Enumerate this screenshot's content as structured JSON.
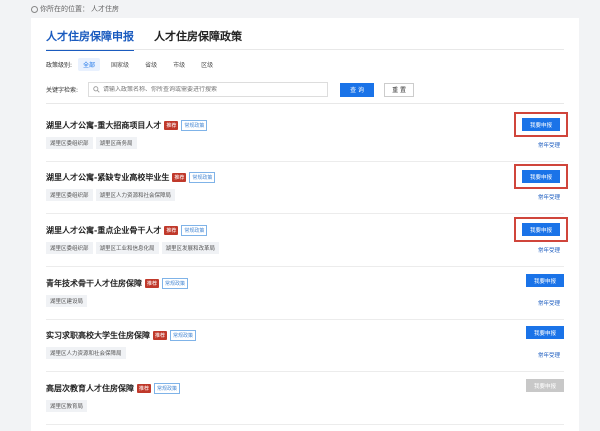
{
  "breadcrumb": {
    "label": "你所在的位置：",
    "current": "人才住房"
  },
  "tabs": [
    {
      "label": "人才住房保障申报"
    },
    {
      "label": "人才住房保障政策"
    }
  ],
  "filter": {
    "label": "政策级别:",
    "options": [
      "全部",
      "国家级",
      "省级",
      "市级",
      "区级"
    ],
    "selected": "全部"
  },
  "search": {
    "label": "关键字检索:",
    "placeholder": "请输入政策名称、你所查询或需要进行搜索",
    "search_label": "查 询",
    "reset_label": "重 置"
  },
  "items": [
    {
      "title": "湖里人才公寓-重大招商项目人才",
      "rec": "推荐",
      "type": "常规政策",
      "orgs": [
        "湖里区委组织部",
        "湖里区商务局"
      ],
      "apply": "我要申报",
      "status": "常年受理",
      "highlight": true,
      "disabled": false
    },
    {
      "title": "湖里人才公寓-紧缺专业高校毕业生",
      "rec": "推荐",
      "type": "常规政策",
      "orgs": [
        "湖里区委组织部",
        "湖里区人力资源和社会保障局"
      ],
      "apply": "我要申报",
      "status": "常年受理",
      "highlight": true,
      "disabled": false
    },
    {
      "title": "湖里人才公寓-重点企业骨干人才",
      "rec": "推荐",
      "type": "常规政策",
      "orgs": [
        "湖里区委组织部",
        "湖里区工业和信息化局",
        "湖里区发展和改革局"
      ],
      "apply": "我要申报",
      "status": "常年受理",
      "highlight": true,
      "disabled": false
    },
    {
      "title": "青年技术骨干人才住房保障",
      "rec": "推荐",
      "type": "常规政策",
      "orgs": [
        "湖里区建设局"
      ],
      "apply": "我要申报",
      "status": "常年受理",
      "highlight": false,
      "disabled": false
    },
    {
      "title": "实习求职高校大学生住房保障",
      "rec": "推荐",
      "type": "常规政策",
      "orgs": [
        "湖里区人力资源和社会保障局"
      ],
      "apply": "我要申报",
      "status": "常年受理",
      "highlight": false,
      "disabled": false
    },
    {
      "title": "高层次教育人才住房保障",
      "rec": "推荐",
      "type": "常规政策",
      "orgs": [
        "湖里区教育局"
      ],
      "apply": "我要申报",
      "status": "",
      "highlight": false,
      "disabled": true
    }
  ],
  "colors": {
    "primary": "#1a73e8",
    "highlight_border": "#d0453b",
    "recommend_tag": "#c0392b"
  }
}
